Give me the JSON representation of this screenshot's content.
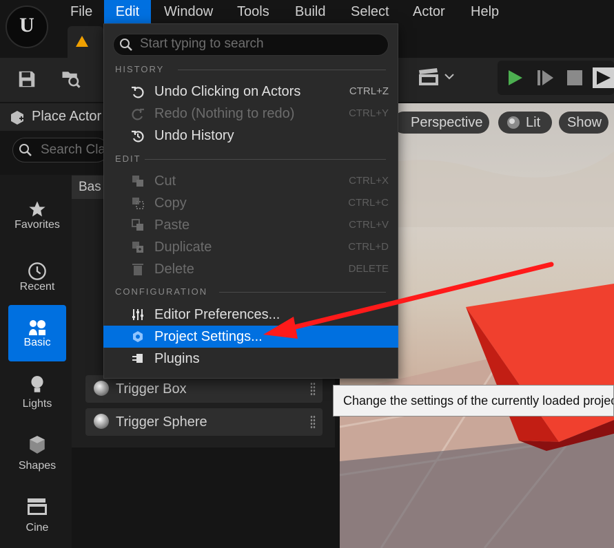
{
  "menubar": {
    "items": [
      {
        "label": "File"
      },
      {
        "label": "Edit"
      },
      {
        "label": "Window"
      },
      {
        "label": "Tools"
      },
      {
        "label": "Build"
      },
      {
        "label": "Select"
      },
      {
        "label": "Actor"
      },
      {
        "label": "Help"
      }
    ],
    "active": "Edit"
  },
  "place_actors": {
    "title": "Place Actor",
    "search_placeholder": "Search Cla",
    "categories": [
      {
        "label": "Favorites",
        "icon": "star-icon"
      },
      {
        "label": "Recent",
        "icon": "clock-icon"
      },
      {
        "label": "Basic",
        "icon": "shapes-icon",
        "active": true
      },
      {
        "label": "Lights",
        "icon": "bulb-icon"
      },
      {
        "label": "Shapes",
        "icon": "cube-icon"
      },
      {
        "label": "Cine",
        "icon": "clapper-icon"
      }
    ],
    "basic_header": "Bas",
    "actors": [
      {
        "label": "Trigger Box"
      },
      {
        "label": "Trigger Sphere"
      }
    ]
  },
  "viewport": {
    "perspective_label": "Perspective",
    "lit_label": "Lit",
    "show_label": "Show"
  },
  "edit_menu": {
    "search_placeholder": "Start typing to search",
    "history_header": "HISTORY",
    "edit_header": "EDIT",
    "config_header": "CONFIGURATION",
    "history": [
      {
        "label": "Undo Clicking on Actors",
        "shortcut": "CTRL+Z",
        "enabled": true
      },
      {
        "label": "Redo (Nothing to redo)",
        "shortcut": "CTRL+Y",
        "enabled": false
      },
      {
        "label": "Undo History",
        "shortcut": "",
        "enabled": true
      }
    ],
    "edit": [
      {
        "label": "Cut",
        "shortcut": "CTRL+X",
        "enabled": false
      },
      {
        "label": "Copy",
        "shortcut": "CTRL+C",
        "enabled": false
      },
      {
        "label": "Paste",
        "shortcut": "CTRL+V",
        "enabled": false
      },
      {
        "label": "Duplicate",
        "shortcut": "CTRL+D",
        "enabled": false
      },
      {
        "label": "Delete",
        "shortcut": "DELETE",
        "enabled": false
      }
    ],
    "configuration": [
      {
        "label": "Editor Preferences..."
      },
      {
        "label": "Project Settings...",
        "highlighted": true
      },
      {
        "label": "Plugins"
      }
    ]
  },
  "tooltip": {
    "text": "Change the settings of the currently loaded project"
  },
  "colors": {
    "accent": "#0070e0",
    "play_green": "#4caf50",
    "warning": "#f0a000",
    "annotation_arrow": "#ff1a1a"
  }
}
